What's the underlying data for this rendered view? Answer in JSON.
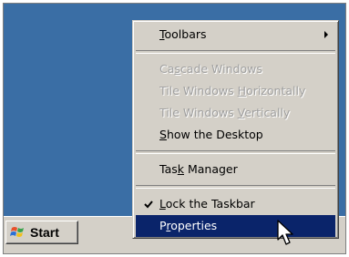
{
  "taskbar": {
    "start_label": "Start"
  },
  "context_menu": {
    "items": [
      {
        "label": "Toolbars",
        "access": "T",
        "rest": "oolbars",
        "prefix": "",
        "enabled": true,
        "submenu": true
      },
      {
        "label": "Cascade Windows",
        "prefix": "Ca",
        "access": "s",
        "rest": "cade Windows",
        "enabled": false
      },
      {
        "label": "Tile Windows Horizontally",
        "prefix": "Tile Windows ",
        "access": "H",
        "rest": "orizontally",
        "enabled": false
      },
      {
        "label": "Tile Windows Vertically",
        "prefix": "Tile Windows ",
        "access": "V",
        "rest": "ertically",
        "enabled": false
      },
      {
        "label": "Show the Desktop",
        "prefix": "",
        "access": "S",
        "rest": "how the Desktop",
        "enabled": true
      },
      {
        "label": "Task Manager",
        "prefix": "Tas",
        "access": "k",
        "rest": " Manager",
        "enabled": true
      },
      {
        "label": "Lock the Taskbar",
        "prefix": "",
        "access": "L",
        "rest": "ock the Taskbar",
        "enabled": true,
        "checked": true
      },
      {
        "label": "Properties",
        "prefix": "P",
        "access": "r",
        "rest": "operties",
        "enabled": true,
        "selected": true
      }
    ]
  },
  "colors": {
    "desktop": "#3a6ea5",
    "face": "#d4d0c8",
    "highlight": "#0a246a"
  },
  "icons": [
    "windows-flag-icon",
    "submenu-arrow-icon",
    "checkmark-icon",
    "mouse-pointer-icon"
  ]
}
